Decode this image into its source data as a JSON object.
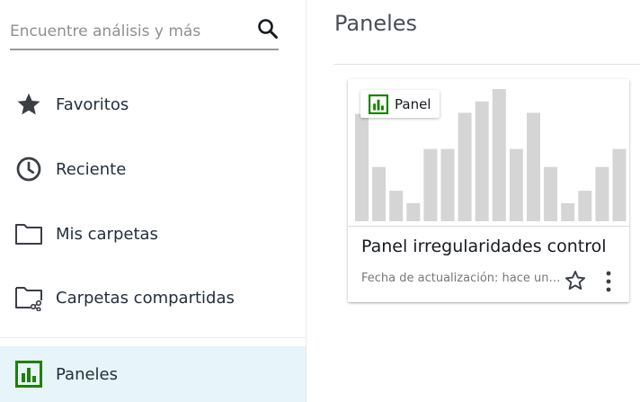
{
  "search": {
    "placeholder": "Encuentre análisis y más",
    "icon": "search-icon"
  },
  "sidebar": {
    "items": [
      {
        "label": "Favoritos",
        "icon": "star-icon"
      },
      {
        "label": "Reciente",
        "icon": "clock-icon"
      },
      {
        "label": "Mis carpetas",
        "icon": "folder-icon"
      },
      {
        "label": "Carpetas compartidas",
        "icon": "shared-folder-icon"
      },
      {
        "label": "Paneles",
        "icon": "dashboard-icon",
        "active": true
      }
    ]
  },
  "main": {
    "title": "Paneles",
    "cards": [
      {
        "type_label": "Panel",
        "title": "Panel irregularidades control",
        "updated": "Fecha de actualización: hace unos segundos",
        "thumbnail_values": [
          95,
          48,
          27,
          16,
          64,
          64,
          96,
          106,
          117,
          64,
          96,
          48,
          16,
          27,
          48,
          64
        ]
      }
    ]
  },
  "colors": {
    "accent_green": "#1d8102",
    "active_bg": "#e7f4f9",
    "thumb_bar": "#d5d5d5"
  }
}
